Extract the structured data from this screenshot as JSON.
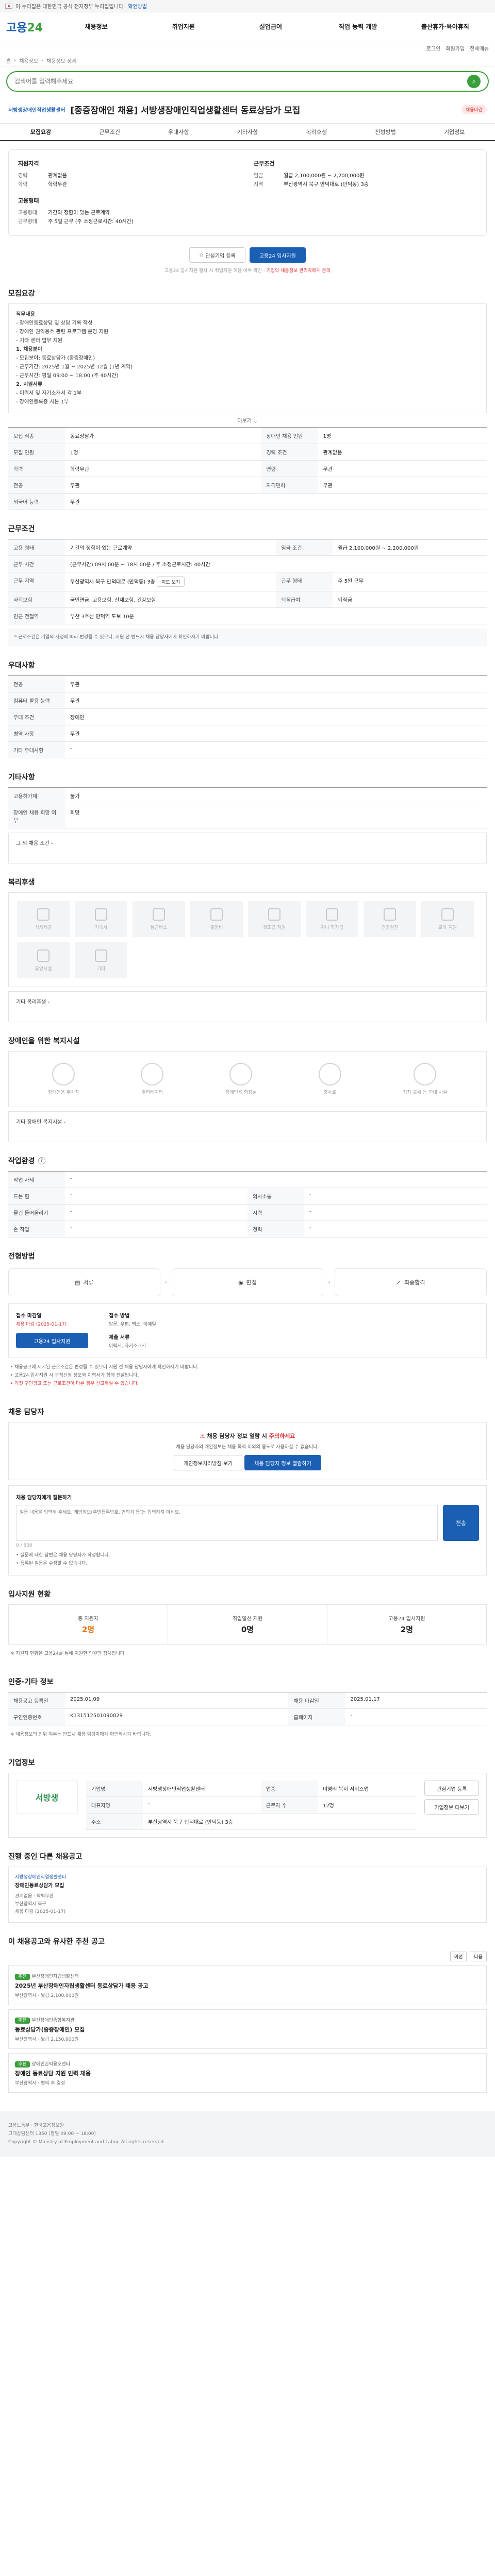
{
  "gov_banner": {
    "text": "이 누리집은 대한민국 공식 전자정부 누리집입니다.",
    "more": "확인방법"
  },
  "header": {
    "logo_main": "고용",
    "logo_sub": "24",
    "menu": [
      "채용정보",
      "취업지원",
      "실업급여",
      "직업 능력 개발",
      "출산휴가·육아휴직"
    ]
  },
  "util": [
    "로그인",
    "회원가입",
    "전체메뉴"
  ],
  "breadcrumb": [
    "홈",
    "채용정보",
    "채용정보 상세"
  ],
  "search": {
    "placeholder": "검색어를 입력해주세요"
  },
  "job": {
    "company": "서방생장애인직업생활센터",
    "title": "[중증장애인 채용] 서방생장애인직업생활센터 동료상담가 모집",
    "badge": "채용마감"
  },
  "subtabs": [
    "모집요강",
    "근무조건",
    "우대사항",
    "기타사항",
    "복리후생",
    "전형방법",
    "기업정보"
  ],
  "summary": {
    "left_title": "지원자격",
    "left": [
      {
        "k": "경력",
        "v": "관계없음"
      },
      {
        "k": "학력",
        "v": "학력무관"
      }
    ],
    "right_title": "근무조건",
    "right": [
      {
        "k": "임금",
        "v": "월급 2,100,000원 ~ 2,200,000원"
      },
      {
        "k": "지역",
        "v": "부산광역시 북구 만덕대로 (만덕동) 3층"
      }
    ],
    "left2_title": "고용형태",
    "left2": [
      {
        "k": "고용형태",
        "v": "기간의 정함이 있는 근로계약"
      },
      {
        "k": "근무형태",
        "v": "주 5일 근무 (주 소정근로시간: 40시간)"
      }
    ],
    "btn_interest": "관심기업 등록",
    "btn_apply": "고용24 입사지원",
    "notice_pre": "고용24 입사지원 절차 시 취업지원 허용 여부 확인",
    "notice_red": "기업의 채용정보 관리자에게 문의"
  },
  "sections": {
    "recruit": "모집요강",
    "work": "근무조건",
    "pref": "우대사항",
    "etc": "기타사항",
    "welfare": "복리후생",
    "disability": "장애인을 위한 복지시설",
    "job_env": "작업환경",
    "process": "전형방법",
    "contact": "채용 담당자",
    "stats": "입사지원 현황",
    "info": "인증·기타 정보",
    "company": "기업정보",
    "ongoing": "진행 중인 다른 채용공고",
    "recommend": "이 채용공고와 유사한 추천 공고"
  },
  "recruit": {
    "body_title": "직무내용",
    "body": [
      "- 장애인동료상담 및 상담 기록 작성",
      "- 장애인 권익옹호 관련 프로그램 운영 지원",
      "- 기타 센터 업무 지원",
      "1. 채용분야",
      "- 모집분야: 동료상담가 (중증장애인)",
      "- 근무기간: 2025년 1월 ~ 2025년 12월 (1년 계약)",
      "- 근무시간: 평일 09:00 ~ 18:00 (주 40시간)",
      "2. 지원서류",
      "- 이력서 및 자기소개서 각 1부",
      "- 장애인등록증 사본 1부"
    ],
    "more": "더보기",
    "table": [
      {
        "k": "모집 직종",
        "v": "동료상담가",
        "k2": "장애인 채용 인원",
        "v2": "1명"
      },
      {
        "k": "모집 인원",
        "v": "1명",
        "k2": "경력 조건",
        "v2": "관계없음"
      },
      {
        "k": "학력",
        "v": "학력무관",
        "k2": "연령",
        "v2": "무관"
      },
      {
        "k": "전공",
        "v": "무관",
        "k2": "자격면허",
        "v2": "무관"
      },
      {
        "k": "외국어 능력",
        "v": "무관",
        "k2": "",
        "v2": ""
      }
    ]
  },
  "work": {
    "table": [
      {
        "k": "고용 형태",
        "v": "기간의 정함이 있는 근로계약",
        "k2": "임금 조건",
        "v2": "월급 2,100,000원 ~ 2,200,000원"
      },
      {
        "k": "근무 시간",
        "v": "(근무시간) 09시 00분 ~ 18시 00분 / 주 소정근로시간: 40시간",
        "k2": "",
        "v2": ""
      },
      {
        "k": "근무 지역",
        "v": "부산광역시 북구 만덕대로 (만덕동) 3층",
        "k2": "근무 형태",
        "v2": "주 5일 근무"
      },
      {
        "k": "사회보험",
        "v": "국민연금, 고용보험, 산재보험, 건강보험",
        "k2": "퇴직급여",
        "v2": "퇴직금"
      },
      {
        "k": "인근 전철역",
        "v": "부산 3호선 만덕역 도보 10분",
        "k2": "",
        "v2": ""
      }
    ],
    "map_btn": "지도 보기",
    "note": "* 근로조건은 기업의 사정에 따라 변경될 수 있으니, 지원 전 반드시 채용 담당자에게 확인하시기 바랍니다."
  },
  "pref": {
    "table": [
      {
        "k": "전공",
        "v": "무관"
      },
      {
        "k": "컴퓨터 활용 능력",
        "v": "무관"
      },
      {
        "k": "우대 조건",
        "v": "장애인"
      },
      {
        "k": "병역 사항",
        "v": "무관"
      },
      {
        "k": "기타 우대사항",
        "v": "-"
      }
    ]
  },
  "etc": {
    "table": [
      {
        "k": "고용허가제",
        "v": "불가"
      },
      {
        "k": "장애인 채용 희망 여부",
        "v": "희망"
      }
    ],
    "extra_label": "그 외 채용 조건",
    "extra_value": "-"
  },
  "welfare": {
    "items": [
      "식사제공",
      "기숙사",
      "통근버스",
      "출장비",
      "경조금 지원",
      "자녀 학자금",
      "건강검진",
      "교육 지원",
      "휴양시설",
      "기타"
    ],
    "extra_label": "기타 복리후생",
    "extra_value": "-"
  },
  "disability": {
    "items": [
      "장애인용 주차장",
      "엘리베이터",
      "장애인용 화장실",
      "경사로",
      "점자 블록 등 안내 시설"
    ],
    "extra_label": "기타 장애인 복지시설",
    "extra_value": "-"
  },
  "job_env": {
    "table": [
      {
        "k": "작업 자세",
        "v": "-",
        "k2": "",
        "v2": ""
      },
      {
        "k": "드는 힘",
        "v": "-",
        "k2": "의사소통",
        "v2": "-"
      },
      {
        "k": "물건 들어올리기",
        "v": "-",
        "k2": "시력",
        "v2": "-"
      },
      {
        "k": "손 작업",
        "v": "-",
        "k2": "청력",
        "v2": "-"
      }
    ]
  },
  "process": {
    "steps": [
      "서류",
      "면접",
      "최종합격"
    ],
    "deadline_label": "접수 마감일",
    "deadline_value": "채용 마감 (2025-01-17)",
    "apply_btn": "고용24 입사지원",
    "how_label": "접수 방법",
    "how_value": "방문, 우편, 팩스, 이메일",
    "docs_label": "제출 서류",
    "docs_value": "이력서, 자기소개서",
    "bullets": [
      "채용공고에 제시된 근로조건은 변경될 수 있으니 지원 전 채용 담당자에게 확인하시기 바랍니다.",
      "고용24 입사지원 시 구직신청 정보와 이력서가 함께 전달됩니다.",
      "거짓 구인광고 또는 근로조건이 다른 경우 신고하실 수 있습니다."
    ]
  },
  "contact": {
    "warn_pre": "채용 담당자 정보 열람 시",
    "warn_red": "주의하세요",
    "desc": "채용 담당자의 개인정보는 채용 목적 이외의 용도로 사용하실 수 없습니다.",
    "btn_view": "개인정보처리방침 보기",
    "btn_info": "채용 담당자 정보 열람하기",
    "inq_title": "채용 담당자에게 질문하기",
    "inq_placeholder": "질문 내용을 입력해 주세요. 개인정보(주민등록번호, 연락처 등)는 입력하지 마세요.",
    "inq_count": "0 / 500",
    "send": "전송",
    "notes": [
      "질문에 대한 답변은 채용 담당자가 작성합니다.",
      "등록된 질문은 수정할 수 없습니다."
    ]
  },
  "stats": {
    "items": [
      {
        "label": "총 지원자",
        "value": "2명"
      },
      {
        "label": "취업알선 지원",
        "value": "0명"
      },
      {
        "label": "고용24 입사지원",
        "value": "2명"
      }
    ],
    "note": "※ 지원자 현황은 고용24를 통해 지원한 인원만 집계됩니다."
  },
  "info": {
    "table": [
      {
        "k": "채용공고 등록일",
        "v": "2025.01.09",
        "k2": "채용 마감일",
        "v2": "2025.01.17"
      },
      {
        "k": "구인인증번호",
        "v": "K131512501090029",
        "k2": "홈페이지",
        "v2": "-"
      }
    ],
    "note": "※ 채용정보의 진위 여부는 반드시 채용 담당자에게 확인하시기 바랍니다."
  },
  "company": {
    "logo_text": "서방생",
    "table": [
      {
        "k": "기업명",
        "v": "서방생장애인직업생활센터",
        "k2": "업종",
        "v2": "비영리 복지 서비스업"
      },
      {
        "k": "대표자명",
        "v": "-",
        "k2": "근로자 수",
        "v2": "12명"
      },
      {
        "k": "주소",
        "v": "부산광역시 북구 만덕대로 (만덕동) 3층",
        "k2": "",
        "v2": ""
      }
    ],
    "btn_interest": "관심기업 등록",
    "btn_more": "기업정보 더보기"
  },
  "ongoing": {
    "card": {
      "name": "서방생장애인직업생활센터",
      "title": "장애인동료상담가 모집",
      "meta": [
        "관계없음 · 학력무관",
        "부산광역시 북구",
        "채용 마감 (2025-01-17)"
      ]
    }
  },
  "recommend": {
    "pager": [
      "이전",
      "다음"
    ],
    "items": [
      {
        "tag": "추천",
        "company": "부산장애인자립생활센터",
        "title": "2025년 부산장애인자립생활센터 동료상담가 채용 공고",
        "meta": "부산광역시 · 월급 2,100,000원"
      },
      {
        "tag": "추천",
        "company": "부산장애인종합복지관",
        "title": "동료상담가(중증장애인) 모집",
        "meta": "부산광역시 · 월급 2,150,000원"
      },
      {
        "tag": "추천",
        "company": "장애인권익옹호센터",
        "title": "장애인 동료상담 지원 인력 채용",
        "meta": "부산광역시 · 협의 후 결정"
      }
    ]
  },
  "footer": {
    "lines": [
      "고용노동부 · 한국고용정보원",
      "고객상담센터 1350 (평일 09:00 ~ 18:00)",
      "Copyright © Ministry of Employment and Labor. All rights reserved."
    ]
  },
  "colors": {
    "brand": "#1a5fb4",
    "accent": "#3a9f3a",
    "alert": "#d33333"
  }
}
